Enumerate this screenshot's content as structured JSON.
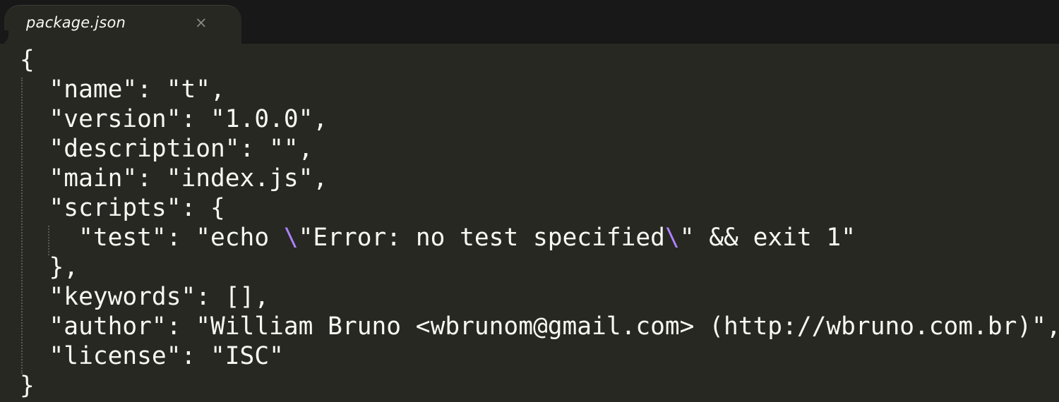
{
  "tab": {
    "title": "package.json",
    "close_glyph": "×",
    "close_icon": "close-icon"
  },
  "colors": {
    "background": "#272822",
    "tabbar": "#181818",
    "text": "#f8f8f2",
    "escape": "#ae81ff",
    "indent_guide": "#5a5a52"
  },
  "code": {
    "lines": [
      "{",
      "  \"name\": \"t\",",
      "  \"version\": \"1.0.0\",",
      "  \"description\": \"\",",
      "  \"main\": \"index.js\",",
      "  \"scripts\": {",
      "    \"test\": \"echo ",
      "  },",
      "  \"keywords\": [],",
      "  \"author\": \"William Bruno <wbrunom@gmail.com> (http://wbruno.com.br)\",",
      "  \"license\": \"ISC\"",
      "}"
    ],
    "test_line": {
      "before": "    \"test\": \"echo ",
      "escape1": "\\",
      "middle": "\"Error: no test specified",
      "escape2": "\\",
      "after": "\" && exit 1\""
    }
  }
}
